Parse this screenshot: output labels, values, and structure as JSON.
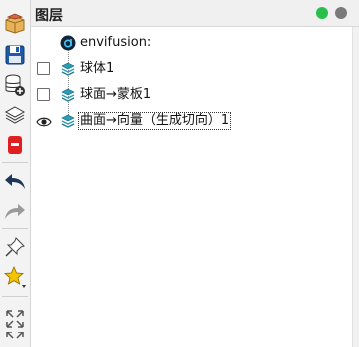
{
  "toolbar": {
    "items": [
      {
        "name": "open-box-icon"
      },
      {
        "name": "save-icon"
      },
      {
        "name": "database-add-icon"
      },
      {
        "name": "layers-icon"
      },
      {
        "name": "bookmark-red-icon"
      },
      {
        "name": "undo-icon"
      },
      {
        "name": "redo-icon"
      },
      {
        "name": "pin-icon"
      },
      {
        "name": "star-dropdown-icon"
      },
      {
        "name": "fit-view-icon"
      },
      {
        "name": "expand-icon"
      }
    ]
  },
  "panel": {
    "title": "图层",
    "status_colors": {
      "green": "#27c04a",
      "gray": "#7a7a7a"
    }
  },
  "tree": {
    "root": {
      "label": "envifusion:"
    },
    "items": [
      {
        "label": "球体1",
        "visible": false
      },
      {
        "label": "球面→蒙板1",
        "visible": false
      },
      {
        "label": "曲面→向量（生成切向）1",
        "visible": true,
        "selected": true
      }
    ]
  },
  "colors": {
    "accent_teal": "#2a9db5",
    "eye_dark": "#222222"
  }
}
